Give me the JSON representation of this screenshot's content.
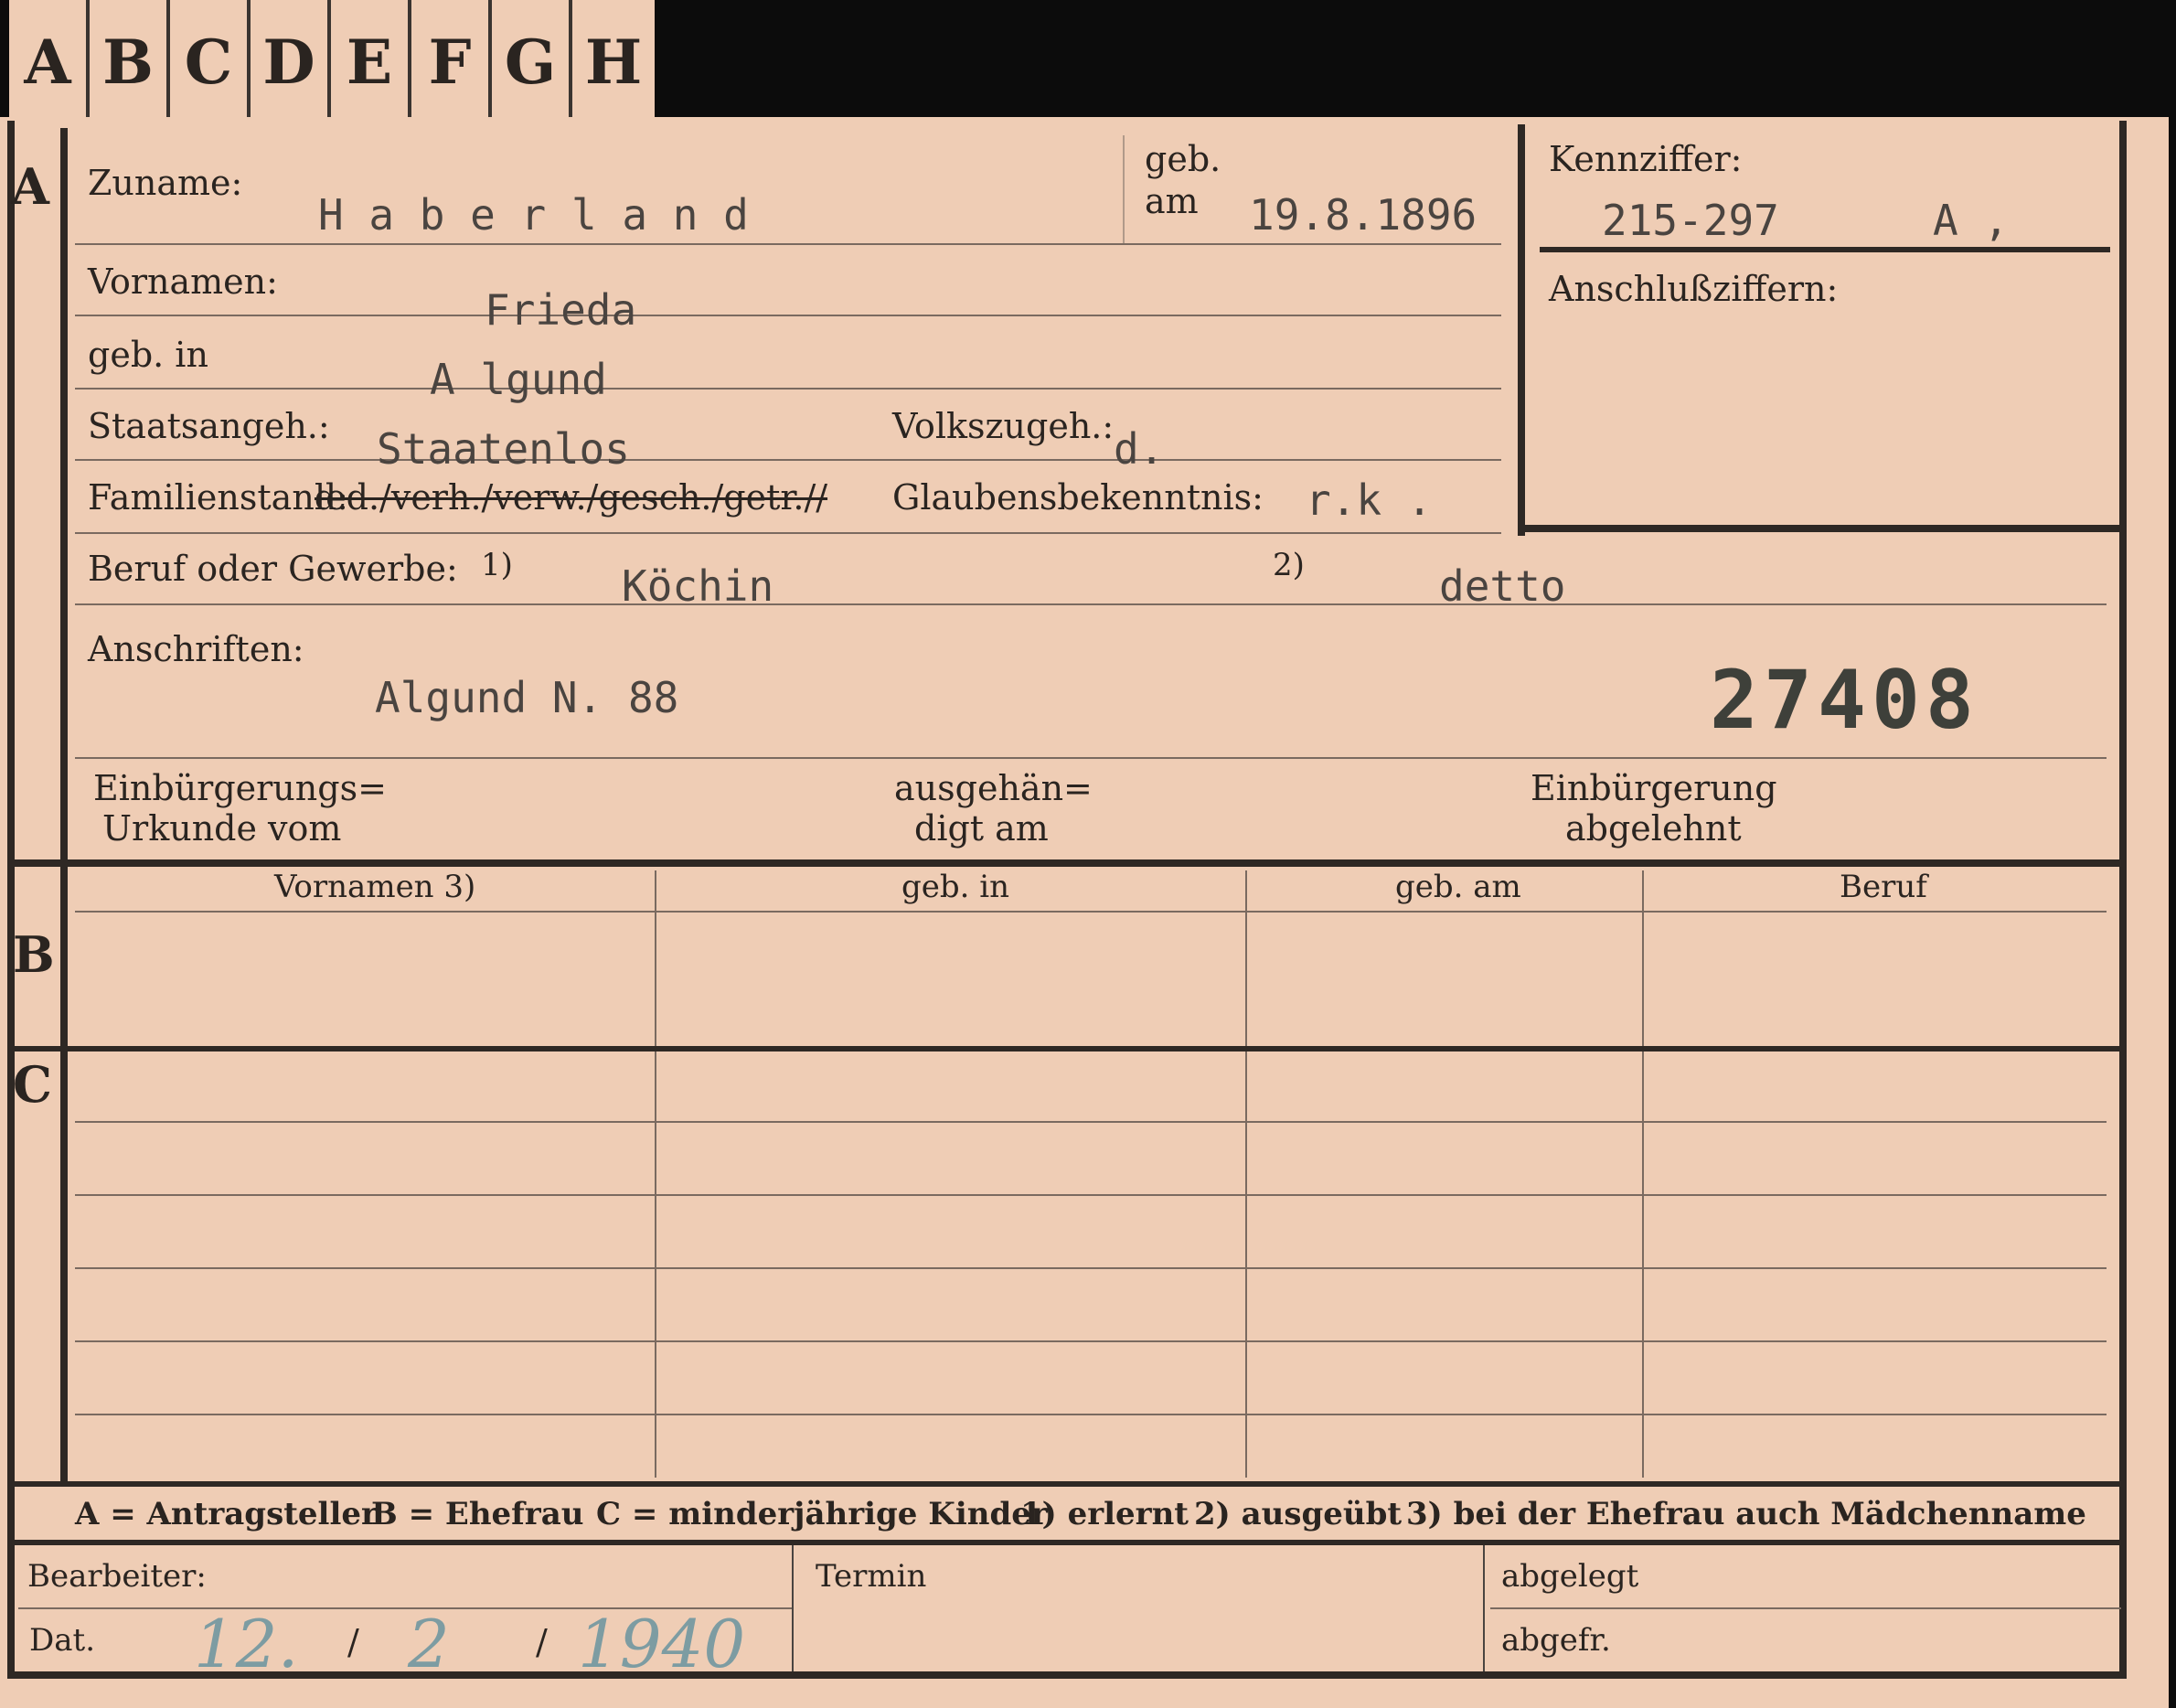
{
  "tabs": [
    "A",
    "B",
    "C",
    "D",
    "E",
    "F",
    "G",
    "H"
  ],
  "sections": {
    "a": "A",
    "b": "B",
    "c": "C"
  },
  "labels": {
    "zuname": "Zuname:",
    "geb": "geb.",
    "am": "am",
    "kennziffer": "Kennziffer:",
    "anschlussziffern": "Anschlußziffern:",
    "vornamen": "Vornamen:",
    "geb_in": "geb. in",
    "staatsangeh": "Staatsangeh.:",
    "volkszugeh": "Volkszugeh.:",
    "familienstand": "Familienstand:",
    "familienstand_options": "led./verh./verw./gesch./getr.//",
    "glaubensbekenntnis": "Glaubensbekenntnis:",
    "beruf_oder_gewerbe": "Beruf oder Gewerbe:",
    "fn1": "1)",
    "fn2": "2)",
    "anschriften": "Anschriften:",
    "einbuergerungs_line1": "Einbürgerungs=",
    "einbuergerungs_line2": "Urkunde vom",
    "ausgehaen_line1": "ausgehän=",
    "ausgehaen_line2": "digt am",
    "einbuergerung_line1": "Einbürgerung",
    "einbuergerung_line2": "abgelehnt"
  },
  "values": {
    "zuname": "H a b e r l a n d",
    "geb_am": "19.8.1896",
    "kennziffer": "215-297",
    "kennziffer_suffix": "A ,",
    "vornamen": "Frieda",
    "geb_in": "A lgund",
    "staatsangeh": "Staatenlos",
    "volkszugeh": "d.",
    "glaubensbekenntnis": "r.k .",
    "beruf_erlernt": "Köchin",
    "beruf_ausgeuebt": "detto",
    "anschrift": "Algund N. 88",
    "stamp_number": "27408"
  },
  "table": {
    "headers": [
      "Vornamen 3)",
      "geb. in",
      "geb. am",
      "Beruf"
    ]
  },
  "legend": {
    "a": "A = Antragsteller",
    "b": "B = Ehefrau",
    "c": "C = minderjährige Kinder",
    "n1": "1) erlernt",
    "n2": "2) ausgeübt",
    "n3": "3) bei der Ehefrau auch Mädchenname"
  },
  "footer": {
    "bearbeiter": "Bearbeiter:",
    "dat": "Dat.",
    "date_day": "12.",
    "date_sep1": "/",
    "date_month": "2",
    "date_sep2": "/",
    "date_year": "1940",
    "termin": "Termin",
    "abgelegt": "abgelegt",
    "abgefr": "abgefr."
  },
  "colors": {
    "card": "#efcdb5",
    "background": "#0c0c0c",
    "ink": "#2a2420",
    "typewriter": "#4a4440",
    "pencil_blue": "#7d9ca2"
  }
}
